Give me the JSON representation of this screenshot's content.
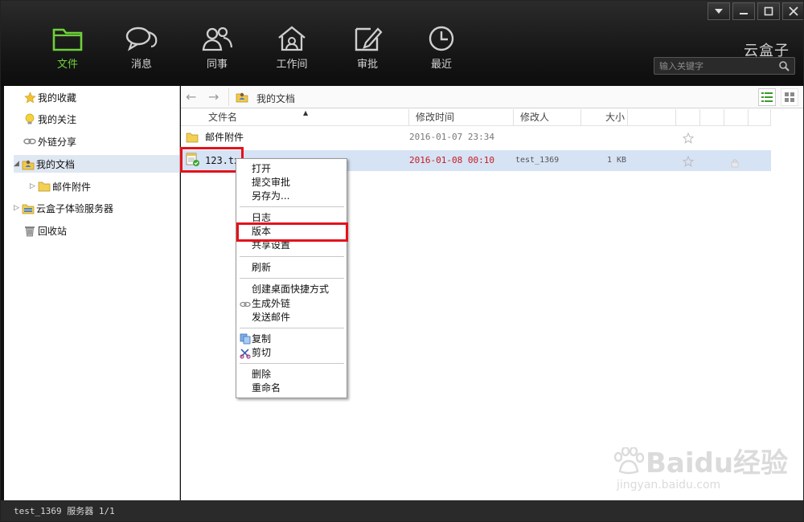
{
  "app": {
    "brand": "云盒子"
  },
  "nav": [
    {
      "label": "文件",
      "icon": "folder-icon",
      "active": true
    },
    {
      "label": "消息",
      "icon": "chat-icon"
    },
    {
      "label": "同事",
      "icon": "colleagues-icon"
    },
    {
      "label": "工作间",
      "icon": "workspace-home-icon"
    },
    {
      "label": "审批",
      "icon": "edit-icon"
    },
    {
      "label": "最近",
      "icon": "clock-icon"
    }
  ],
  "search": {
    "placeholder": "输入关键字"
  },
  "sidebar": {
    "items": [
      {
        "label": "我的收藏",
        "icon": "star-icon"
      },
      {
        "label": "我的关注",
        "icon": "bulb-icon"
      },
      {
        "label": "外链分享",
        "icon": "link-icon"
      },
      {
        "label": "我的文档",
        "icon": "my-docs-icon"
      },
      {
        "label": "邮件附件",
        "icon": "folder-icon"
      },
      {
        "label": "云盒子体验服务器",
        "icon": "server-icon"
      },
      {
        "label": "回收站",
        "icon": "trash-icon"
      }
    ]
  },
  "toolbar": {
    "breadcrumb": "我的文档"
  },
  "table": {
    "columns": [
      "文件名",
      "修改时间",
      "修改人",
      "大小"
    ],
    "rows": [
      {
        "name": "邮件附件",
        "modified": "2016-01-07 23:34",
        "modifier": "",
        "size": ""
      },
      {
        "name": "123.txt",
        "modified": "2016-01-08 00:10",
        "modifier": "test_1369",
        "size": "1 KB"
      }
    ]
  },
  "context_menu": {
    "groups": [
      [
        "打开",
        "提交审批",
        "另存为..."
      ],
      [
        "日志",
        "版本",
        "共享设置"
      ],
      [
        "刷新"
      ],
      [
        "创建桌面快捷方式",
        "生成外链",
        "发送邮件"
      ],
      [
        "复制",
        "剪切"
      ],
      [
        "删除",
        "重命名"
      ]
    ]
  },
  "status": {
    "text": "test_1369  服务器 1/1"
  },
  "watermark": {
    "text1": "Baidu经验",
    "text2": "jingyan.baidu.com"
  },
  "colors": {
    "accent": "#6ed13a",
    "highlight": "#e4121b",
    "date_red": "#c8191f"
  }
}
